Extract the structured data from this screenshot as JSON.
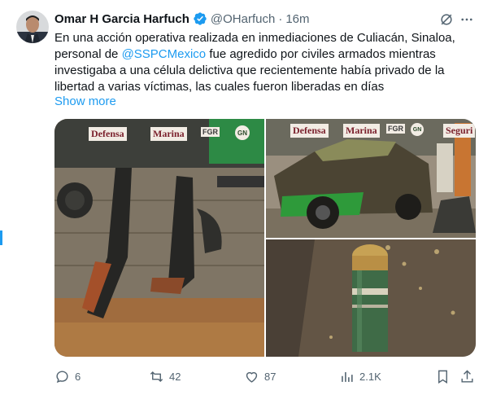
{
  "tweet": {
    "author_name": "Omar H Garcia Harfuch",
    "author_handle": "@OHarfuch",
    "separator": "·",
    "time": "16m",
    "text_before": "En una acción operativa realizada en inmediaciones de Culiacán, Sinaloa, personal de ",
    "mention": "@SSPCMexico",
    "text_after": " fue agredido por civiles armados mientras investigaba a una célula delictiva que recientemente había privado de la libertad a varias víctimas, las cuales fueron liberadas en días",
    "show_more": "Show more"
  },
  "media": {
    "banner_defensa": "Defensa",
    "banner_marina": "Marina",
    "banner_fgr": "FGR",
    "banner_gn": "GN",
    "banner_seguridad": "Seguri"
  },
  "actions": {
    "replies": "6",
    "reposts": "42",
    "likes": "87",
    "views": "2.1K"
  },
  "colors": {
    "accent": "#1d9bf0",
    "secondary_text": "#536471",
    "primary_text": "#0f1419"
  }
}
